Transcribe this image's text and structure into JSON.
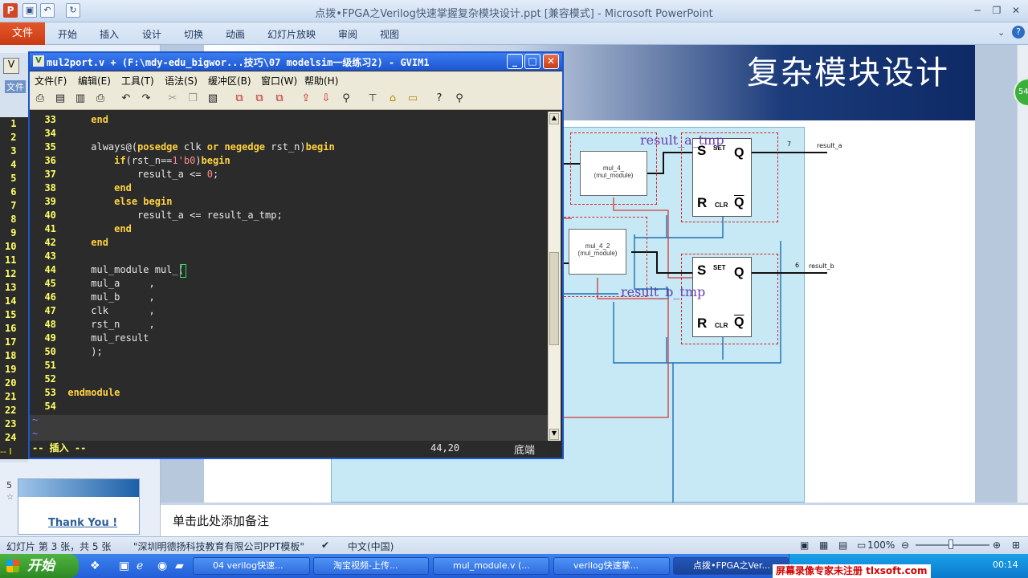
{
  "ppt": {
    "title": "点拨•FPGA之Verilog快速掌握复杂模块设计.ppt [兼容模式] - Microsoft PowerPoint",
    "tabs": [
      "文件",
      "开始",
      "插入",
      "设计",
      "切换",
      "动画",
      "幻灯片放映",
      "审阅",
      "视图"
    ],
    "slide_heading": "复杂模块设计",
    "notes_placeholder": "单击此处添加备注",
    "thumb_number": "5",
    "thumb_text": "Thank You !",
    "status": {
      "slide_info": "幻灯片 第 3 张，共 5 张",
      "template": "\"深圳明德扬科技教育有限公司PPT模板\"",
      "language": "中文(中国)",
      "zoom": "100%"
    },
    "badge": "54"
  },
  "gvim": {
    "title": "mul2port.v + (F:\\mdy-edu_bigwor...技巧\\07 modelsim一级练习2) - GVIM1",
    "menu": [
      "文件(F)",
      "编辑(E)",
      "工具(T)",
      "语法(S)",
      "缓冲区(B)",
      "窗口(W)",
      "帮助(H)"
    ],
    "lines": [
      {
        "n": "33",
        "text": "    end"
      },
      {
        "n": "34",
        "text": ""
      },
      {
        "n": "35",
        "text": "    always@(posedge clk or negedge rst_n)begin"
      },
      {
        "n": "36",
        "text": "        if(rst_n==1'b0)begin"
      },
      {
        "n": "37",
        "text": "            result_a <= 0;"
      },
      {
        "n": "38",
        "text": "        end"
      },
      {
        "n": "39",
        "text": "        else begin"
      },
      {
        "n": "40",
        "text": "            result_a <= result_a_tmp;"
      },
      {
        "n": "41",
        "text": "        end"
      },
      {
        "n": "42",
        "text": "    end"
      },
      {
        "n": "43",
        "text": ""
      },
      {
        "n": "44",
        "text": "    mul_module mul_("
      },
      {
        "n": "45",
        "text": "    mul_a     ,"
      },
      {
        "n": "46",
        "text": "    mul_b     ,"
      },
      {
        "n": "47",
        "text": "    clk       ,"
      },
      {
        "n": "48",
        "text": "    rst_n     ,"
      },
      {
        "n": "49",
        "text": "    mul_result"
      },
      {
        "n": "50",
        "text": "    );"
      },
      {
        "n": "51",
        "text": ""
      },
      {
        "n": "52",
        "text": ""
      },
      {
        "n": "53",
        "text": "endmodule"
      },
      {
        "n": "54",
        "text": ""
      }
    ],
    "mode": "-- 插入 --",
    "position": "44,20",
    "scroll_pos": "底端"
  },
  "left_line_numbers": [
    "1",
    "2",
    "3",
    "4",
    "5",
    "6",
    "7",
    "8",
    "9",
    "10",
    "11",
    "12",
    "13",
    "14",
    "15",
    "16",
    "17",
    "18",
    "19",
    "20",
    "21",
    "22",
    "23",
    "24"
  ],
  "diagram": {
    "signal_a": "result_a_tmp",
    "signal_b": "result_b_tmp",
    "mul1_name": "mul_4_",
    "mul1_sub": "(mul_module)",
    "mul2_name": "mul_4_2",
    "mul2_sub": "(mul_module)",
    "out_a": "result_a",
    "out_b": "result_b",
    "width_a": "7",
    "width_b": "6",
    "ff_s": "S",
    "ff_set": "SET",
    "ff_q": "Q",
    "ff_r": "R",
    "ff_clr": "CLR",
    "ff_qbar": "Q"
  },
  "taskbar": {
    "start": "开始",
    "tasks": [
      "04 verilog快速...",
      "淘宝视频-上传...",
      "mul_module.v (...",
      "verilog快速掌...",
      "点拨•FPGA之Ver..."
    ],
    "watermark": "屏幕录像专家未注册 tlxsoft.com",
    "clock": "00:14"
  }
}
